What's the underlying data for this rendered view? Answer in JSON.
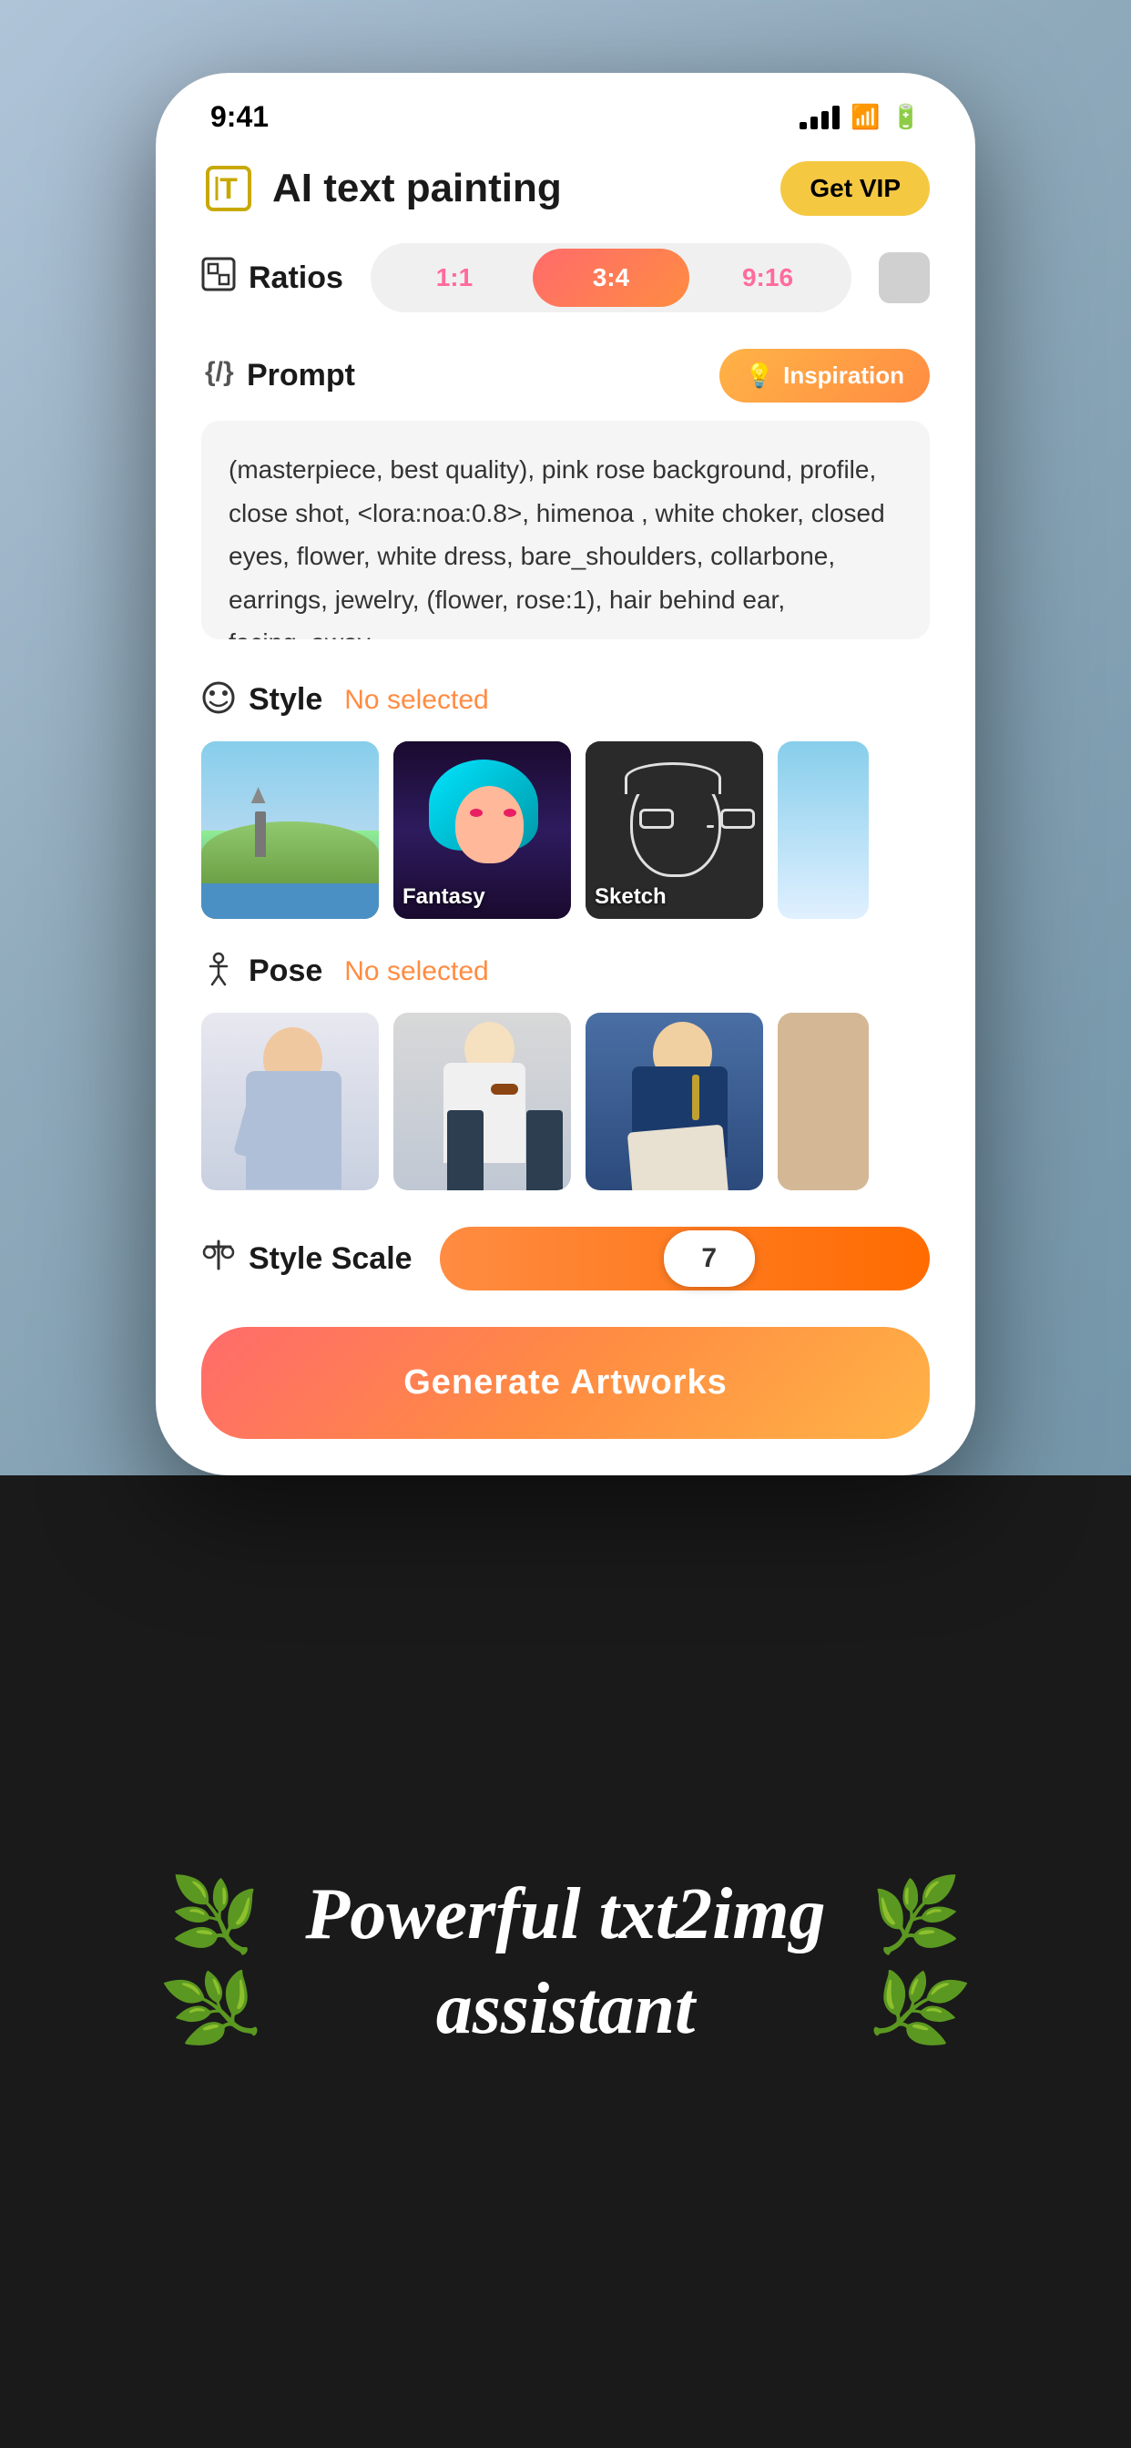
{
  "statusBar": {
    "time": "9:41",
    "signal": "●●●●",
    "wifi": "wifi",
    "battery": "battery"
  },
  "header": {
    "icon": "🖊",
    "title": "AI text painting",
    "vipLabel": "Get VIP"
  },
  "ratios": {
    "label": "Ratios",
    "options": [
      {
        "value": "1:1",
        "active": false
      },
      {
        "value": "3:4",
        "active": true
      },
      {
        "value": "9:16",
        "active": false
      }
    ]
  },
  "prompt": {
    "label": "Prompt",
    "inspirationLabel": "Inspiration",
    "value": "(masterpiece, best quality), pink rose background, profile, close shot, <lora:noa:0.8>, himenoa , white choker, closed eyes, flower, white dress, bare_shoulders, collarbone, earrings, jewelry, (flower, rose:1), hair behind ear, facing_away,"
  },
  "style": {
    "label": "Style",
    "noSelected": "No selected",
    "items": [
      {
        "label": "",
        "type": "landscape"
      },
      {
        "label": "Fantasy",
        "type": "fantasy"
      },
      {
        "label": "Sketch",
        "type": "sketch"
      },
      {
        "label": "",
        "type": "anime"
      }
    ]
  },
  "pose": {
    "label": "Pose",
    "noSelected": "No selected",
    "items": [
      {
        "label": "",
        "type": "pose1"
      },
      {
        "label": "",
        "type": "pose2"
      },
      {
        "label": "",
        "type": "pose3"
      },
      {
        "label": "",
        "type": "pose4"
      }
    ]
  },
  "styleScale": {
    "label": "Style Scale",
    "value": "7"
  },
  "generateBtn": {
    "label": "Generate Artworks"
  },
  "banner": {
    "line1": "Powerful txt2img",
    "line2": "assistant"
  }
}
